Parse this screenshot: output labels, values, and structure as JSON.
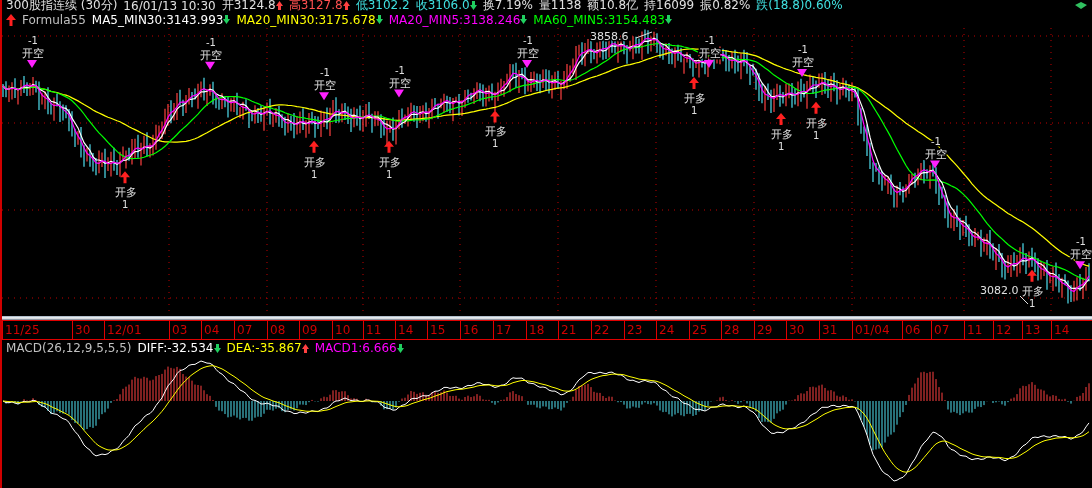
{
  "quote_bar": [
    {
      "text": "300股指连续 (30分)",
      "color": "#e0e0e0"
    },
    {
      "text": "16/01/13 10:30",
      "color": "#e0e0e0"
    },
    {
      "text": "开3124.8",
      "color": "#e0e0e0",
      "rising": true
    },
    {
      "text": "高3127.8",
      "color": "#ff5050",
      "rising": true
    },
    {
      "text": "低3102.2",
      "color": "#40e0e0"
    },
    {
      "text": "收3106.0",
      "color": "#40e0e0",
      "rising": false
    },
    {
      "text": "换7.19%",
      "color": "#e0e0e0"
    },
    {
      "text": "量1138",
      "color": "#e0e0e0"
    },
    {
      "text": "额10.8亿",
      "color": "#e0e0e0"
    },
    {
      "text": "持16099",
      "color": "#e0e0e0"
    },
    {
      "text": "振0.82%",
      "color": "#e0e0e0"
    },
    {
      "text": "跌(18.8)0.60%",
      "color": "#40e0e0"
    }
  ],
  "formula": {
    "name": "Formula55",
    "legend": [
      {
        "text": "MA5_MIN30:3143.993",
        "color": "#ffffff",
        "rising": false
      },
      {
        "text": "MA20_MIN30:3175.678",
        "color": "#ffff00",
        "rising": false
      },
      {
        "text": "MA20_MIN5:3138.246",
        "color": "#ff00ff",
        "rising": false
      },
      {
        "text": "MA60_MIN5:3154.483",
        "color": "#00ff00",
        "rising": false
      }
    ]
  },
  "signals": [
    {
      "kind": "sell",
      "count": "-1",
      "action": "开空"
    },
    {
      "kind": "buy",
      "count": "1",
      "action": "开多"
    },
    {
      "kind": "sell",
      "count": "-1",
      "action": "开空"
    },
    {
      "kind": "buy",
      "count": "1",
      "action": "开多"
    },
    {
      "kind": "sell",
      "count": "-1",
      "action": "开空"
    },
    {
      "kind": "buy",
      "count": "1",
      "action": "开多"
    },
    {
      "kind": "sell",
      "count": "-1",
      "action": "开空"
    },
    {
      "kind": "buy",
      "count": "1",
      "action": "开多"
    },
    {
      "kind": "sell",
      "count": "-1",
      "action": "开空"
    },
    {
      "kind": "buy",
      "count": "1",
      "action": "开多"
    },
    {
      "kind": "sell",
      "count": "-1",
      "action": "开空"
    },
    {
      "kind": "buy",
      "count": "1",
      "action": "开多"
    },
    {
      "kind": "sell",
      "count": "-1",
      "action": "开空"
    },
    {
      "kind": "buy",
      "count": "1",
      "action": "开多"
    },
    {
      "kind": "sell",
      "count": "-1",
      "action": "开空"
    },
    {
      "kind": "buy",
      "count": "1",
      "action": "开多"
    },
    {
      "kind": "sell",
      "count": "-1",
      "action": "开空"
    }
  ],
  "price_labels": [
    {
      "kind": "high",
      "text": "3858.6"
    },
    {
      "kind": "low",
      "text": "3082.0"
    }
  ],
  "dates": [
    "11/25",
    "30",
    "12/01",
    "03",
    "04",
    "07",
    "08",
    "09",
    "10",
    "11",
    "14",
    "15",
    "16",
    "17",
    "18",
    "21",
    "22",
    "23",
    "24",
    "25",
    "28",
    "29",
    "30",
    "31",
    "01/04",
    "06",
    "07",
    "11",
    "12",
    "13",
    "14"
  ],
  "macd": {
    "title": "MACD(26,12,9,5,5,5)",
    "legend": [
      {
        "text": "DIFF:-32.534",
        "color": "#ffffff",
        "rising": false
      },
      {
        "text": "DEA:-35.867",
        "color": "#ffff00",
        "rising": true
      },
      {
        "text": "MACD1:6.666",
        "color": "#ff00ff",
        "rising": false
      }
    ]
  }
}
